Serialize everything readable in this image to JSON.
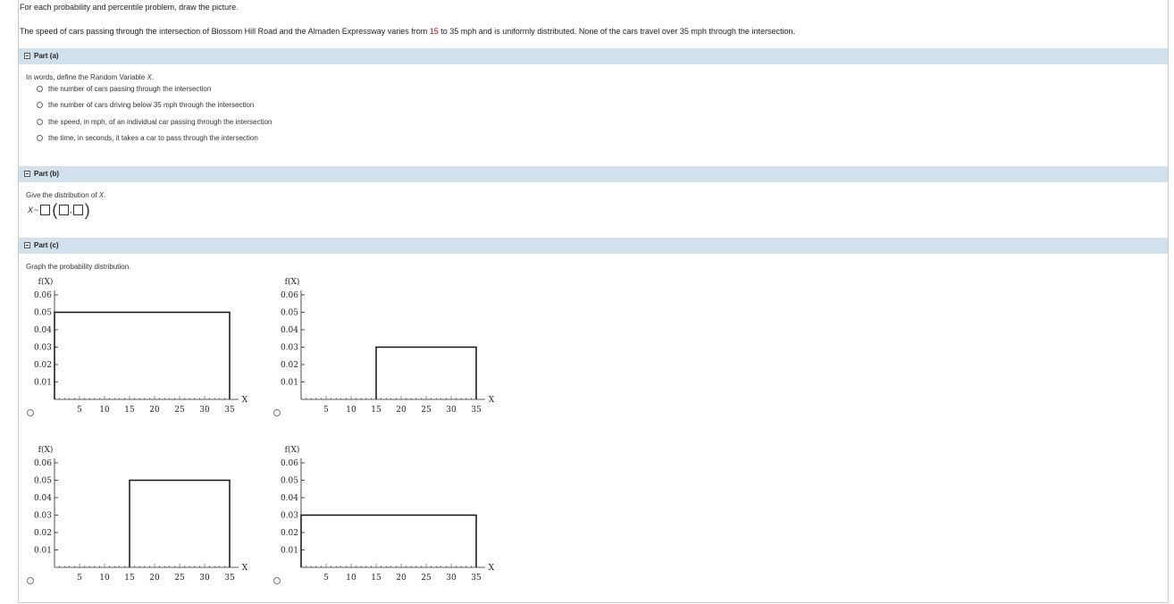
{
  "intro": {
    "instruction": "For each probability and percentile problem, draw the picture.",
    "problem_before": "The speed of cars passing through the intersection of Blossom Hill Road and the Almaden Expressway varies from ",
    "low": "15",
    "problem_mid": " to 35 mph and is uniformly distributed. None of the cars travel over 35 mph through the intersection."
  },
  "part_a": {
    "header": "Part (a)",
    "question_prefix": "In words, define the Random Variable ",
    "question_var": "X",
    "question_suffix": ".",
    "options": [
      "the number of cars passing through the intersection",
      "the number of cars driving below 35 mph through the intersection",
      "the speed, in mph, of an individual car passing through the intersection",
      "the time, in seconds, it takes a car to pass through the intersection"
    ]
  },
  "part_b": {
    "header": "Part (b)",
    "question_prefix": "Give the distribution of ",
    "question_var": "X",
    "question_suffix": ".",
    "x_label": "X",
    "tilde": "~",
    "comma": ","
  },
  "part_c": {
    "header": "Part (c)",
    "question": "Graph the probability distribution.",
    "ylabel": "f(X)",
    "xlabel": "X"
  },
  "chart_data": [
    {
      "type": "area",
      "title": "",
      "xlabel": "X",
      "ylabel": "f(X)",
      "xlim": [
        0,
        35
      ],
      "ylim": [
        0,
        0.06
      ],
      "xticks": [
        5,
        10,
        15,
        20,
        25,
        30,
        35
      ],
      "yticks": [
        0.01,
        0.02,
        0.03,
        0.04,
        0.05,
        0.06
      ],
      "rect": {
        "x0": 0,
        "x1": 35,
        "y": 0.05
      }
    },
    {
      "type": "area",
      "title": "",
      "xlabel": "X",
      "ylabel": "f(X)",
      "xlim": [
        0,
        35
      ],
      "ylim": [
        0,
        0.06
      ],
      "xticks": [
        5,
        10,
        15,
        20,
        25,
        30,
        35
      ],
      "yticks": [
        0.01,
        0.02,
        0.03,
        0.04,
        0.05,
        0.06
      ],
      "rect": {
        "x0": 15,
        "x1": 35,
        "y": 0.03
      }
    },
    {
      "type": "area",
      "title": "",
      "xlabel": "X",
      "ylabel": "f(X)",
      "xlim": [
        0,
        35
      ],
      "ylim": [
        0,
        0.06
      ],
      "xticks": [
        5,
        10,
        15,
        20,
        25,
        30,
        35
      ],
      "yticks": [
        0.01,
        0.02,
        0.03,
        0.04,
        0.05,
        0.06
      ],
      "rect": {
        "x0": 15,
        "x1": 35,
        "y": 0.05
      }
    },
    {
      "type": "area",
      "title": "",
      "xlabel": "X",
      "ylabel": "f(X)",
      "xlim": [
        0,
        35
      ],
      "ylim": [
        0,
        0.06
      ],
      "xticks": [
        5,
        10,
        15,
        20,
        25,
        30,
        35
      ],
      "yticks": [
        0.01,
        0.02,
        0.03,
        0.04,
        0.05,
        0.06
      ],
      "rect": {
        "x0": 0,
        "x1": 35,
        "y": 0.03
      }
    }
  ]
}
